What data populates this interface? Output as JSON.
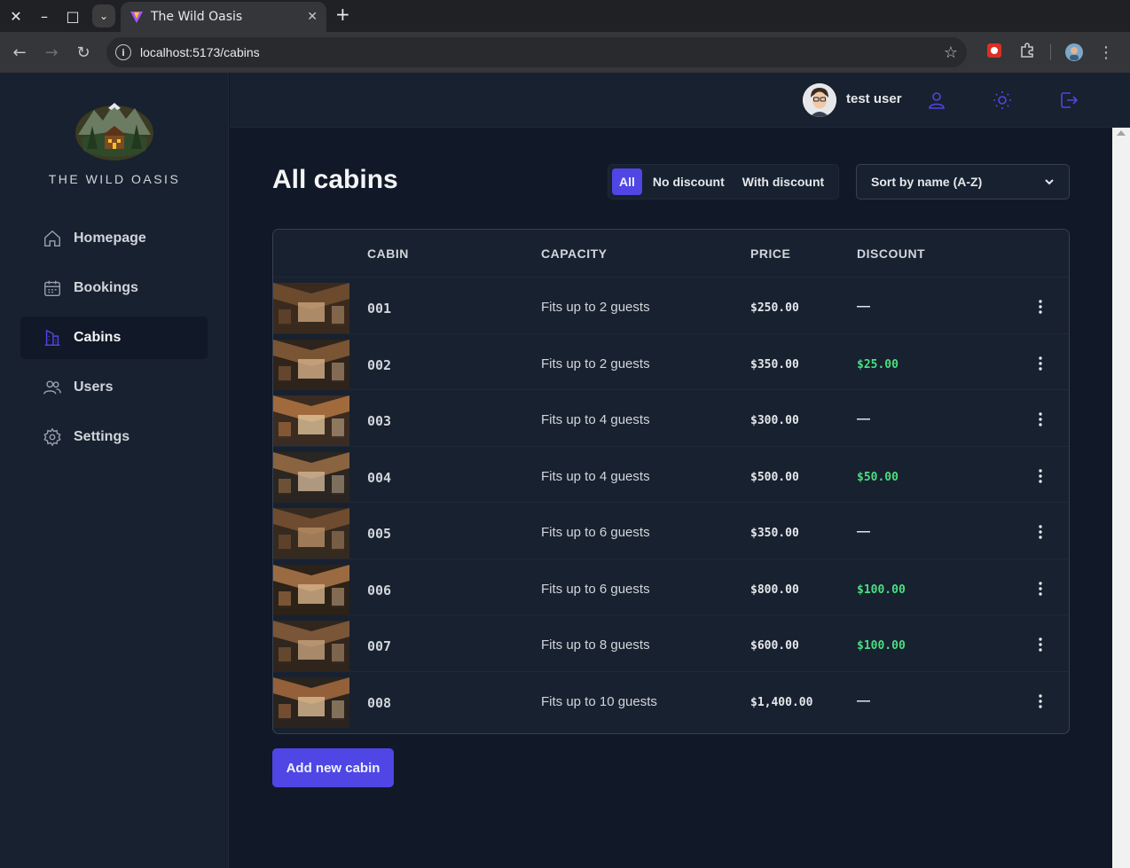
{
  "browser": {
    "tab_title": "The Wild Oasis",
    "url": "localhost:5173/cabins"
  },
  "sidebar": {
    "logo_text": "THE WILD OASIS",
    "items": [
      {
        "label": "Homepage",
        "icon": "home-icon",
        "active": false
      },
      {
        "label": "Bookings",
        "icon": "calendar-icon",
        "active": false
      },
      {
        "label": "Cabins",
        "icon": "building-icon",
        "active": true
      },
      {
        "label": "Users",
        "icon": "users-icon",
        "active": false
      },
      {
        "label": "Settings",
        "icon": "gear-icon",
        "active": false
      }
    ]
  },
  "header": {
    "username": "test user"
  },
  "main": {
    "title": "All cabins",
    "filters": [
      "All",
      "No discount",
      "With discount"
    ],
    "active_filter": "All",
    "sort_label": "Sort by name (A-Z)",
    "add_button": "Add new cabin"
  },
  "table": {
    "columns": [
      "",
      "CABIN",
      "CAPACITY",
      "PRICE",
      "DISCOUNT",
      ""
    ],
    "rows": [
      {
        "name": "001",
        "capacity": "Fits up to 2 guests",
        "price": "$250.00",
        "discount": "—"
      },
      {
        "name": "002",
        "capacity": "Fits up to 2 guests",
        "price": "$350.00",
        "discount": "$25.00"
      },
      {
        "name": "003",
        "capacity": "Fits up to 4 guests",
        "price": "$300.00",
        "discount": "—"
      },
      {
        "name": "004",
        "capacity": "Fits up to 4 guests",
        "price": "$500.00",
        "discount": "$50.00"
      },
      {
        "name": "005",
        "capacity": "Fits up to 6 guests",
        "price": "$350.00",
        "discount": "—"
      },
      {
        "name": "006",
        "capacity": "Fits up to 6 guests",
        "price": "$800.00",
        "discount": "$100.00"
      },
      {
        "name": "007",
        "capacity": "Fits up to 8 guests",
        "price": "$600.00",
        "discount": "$100.00"
      },
      {
        "name": "008",
        "capacity": "Fits up to 10 guests",
        "price": "$1,400.00",
        "discount": "—"
      }
    ]
  },
  "colors": {
    "accent": "#4f46e5",
    "discount": "#4ade80",
    "background": "#111827",
    "panel": "#18212f"
  }
}
